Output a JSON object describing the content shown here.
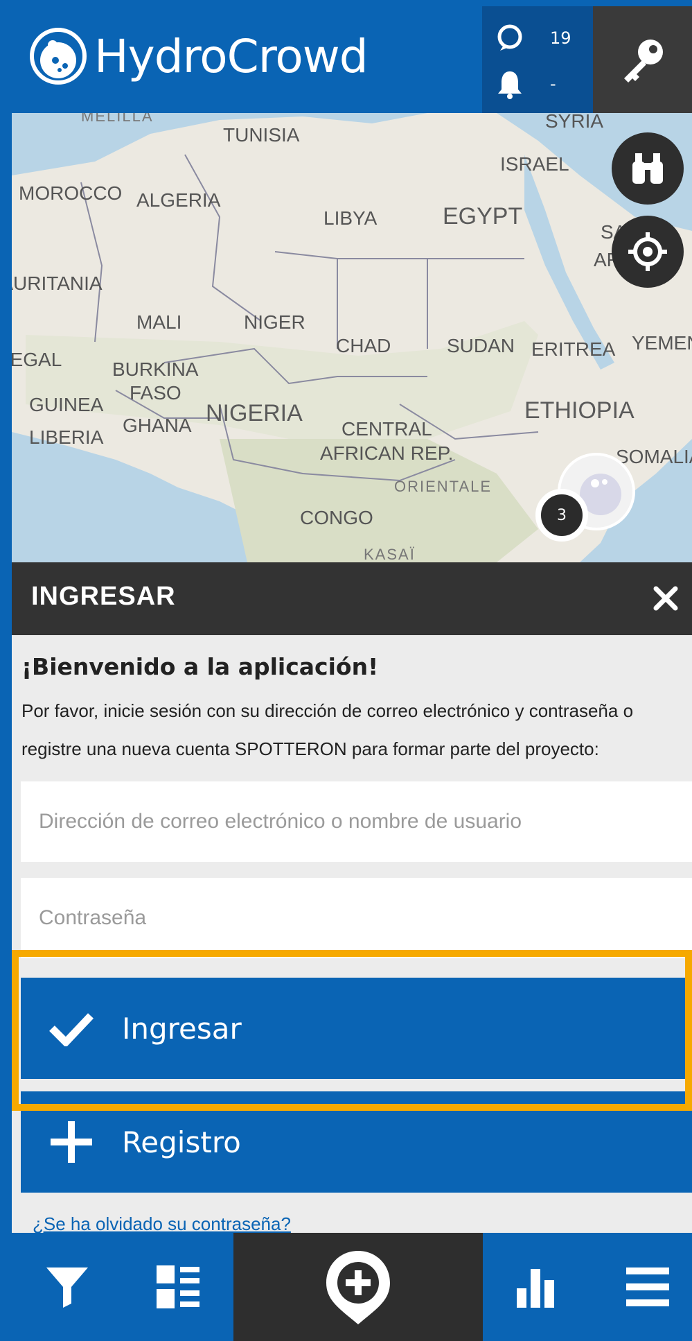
{
  "header": {
    "app_name": "HydroCrowd",
    "spots_count": "19",
    "notifications_count": "-"
  },
  "map": {
    "labels": {
      "melilla": "MELILLA",
      "tunisia": "TUNISIA",
      "syria": "SYRIA",
      "israel": "ISRAEL",
      "morocco": "MOROCCO",
      "algeria": "ALGERIA",
      "libya": "LIBYA",
      "egypt": "EGYPT",
      "saudi": "SAUDI",
      "arabia": "ARABIA",
      "mauritania": "MAURITANIA",
      "mali": "MALI",
      "niger": "NIGER",
      "chad": "CHAD",
      "sudan": "SUDAN",
      "eritrea": "ERITREA",
      "yemen": "YEMEN",
      "senegal": "SENEGAL",
      "burkina": "BURKINA",
      "faso": "FASO",
      "guinea": "GUINEA",
      "ghana": "GHANA",
      "nigeria": "NIGERIA",
      "liberia": "LIBERIA",
      "central": "CENTRAL",
      "african_rep": "AFRICAN REP.",
      "ethiopia": "ETHIOPIA",
      "somalia": "SOMALIA",
      "orientale": "ORIENTALE",
      "congo": "CONGO",
      "kasai": "KASAÏ"
    },
    "cluster_count": "3"
  },
  "login": {
    "title": "INGRESAR",
    "welcome": "¡Bienvenido a la aplicación!",
    "intro": "Por favor, inicie sesión con su dirección de correo electrónico y contraseña o registre una nueva cuenta SPOTTERON para formar parte del proyecto:",
    "email_placeholder": "Dirección de correo electrónico o nombre de usuario",
    "password_placeholder": "Contraseña",
    "login_label": "Ingresar",
    "register_label": "Registro",
    "forgot_label": "¿Se ha olvidado su contraseña?"
  },
  "colors": {
    "brand_blue": "#0a64b4",
    "dark": "#333333",
    "highlight": "#f6a900"
  }
}
